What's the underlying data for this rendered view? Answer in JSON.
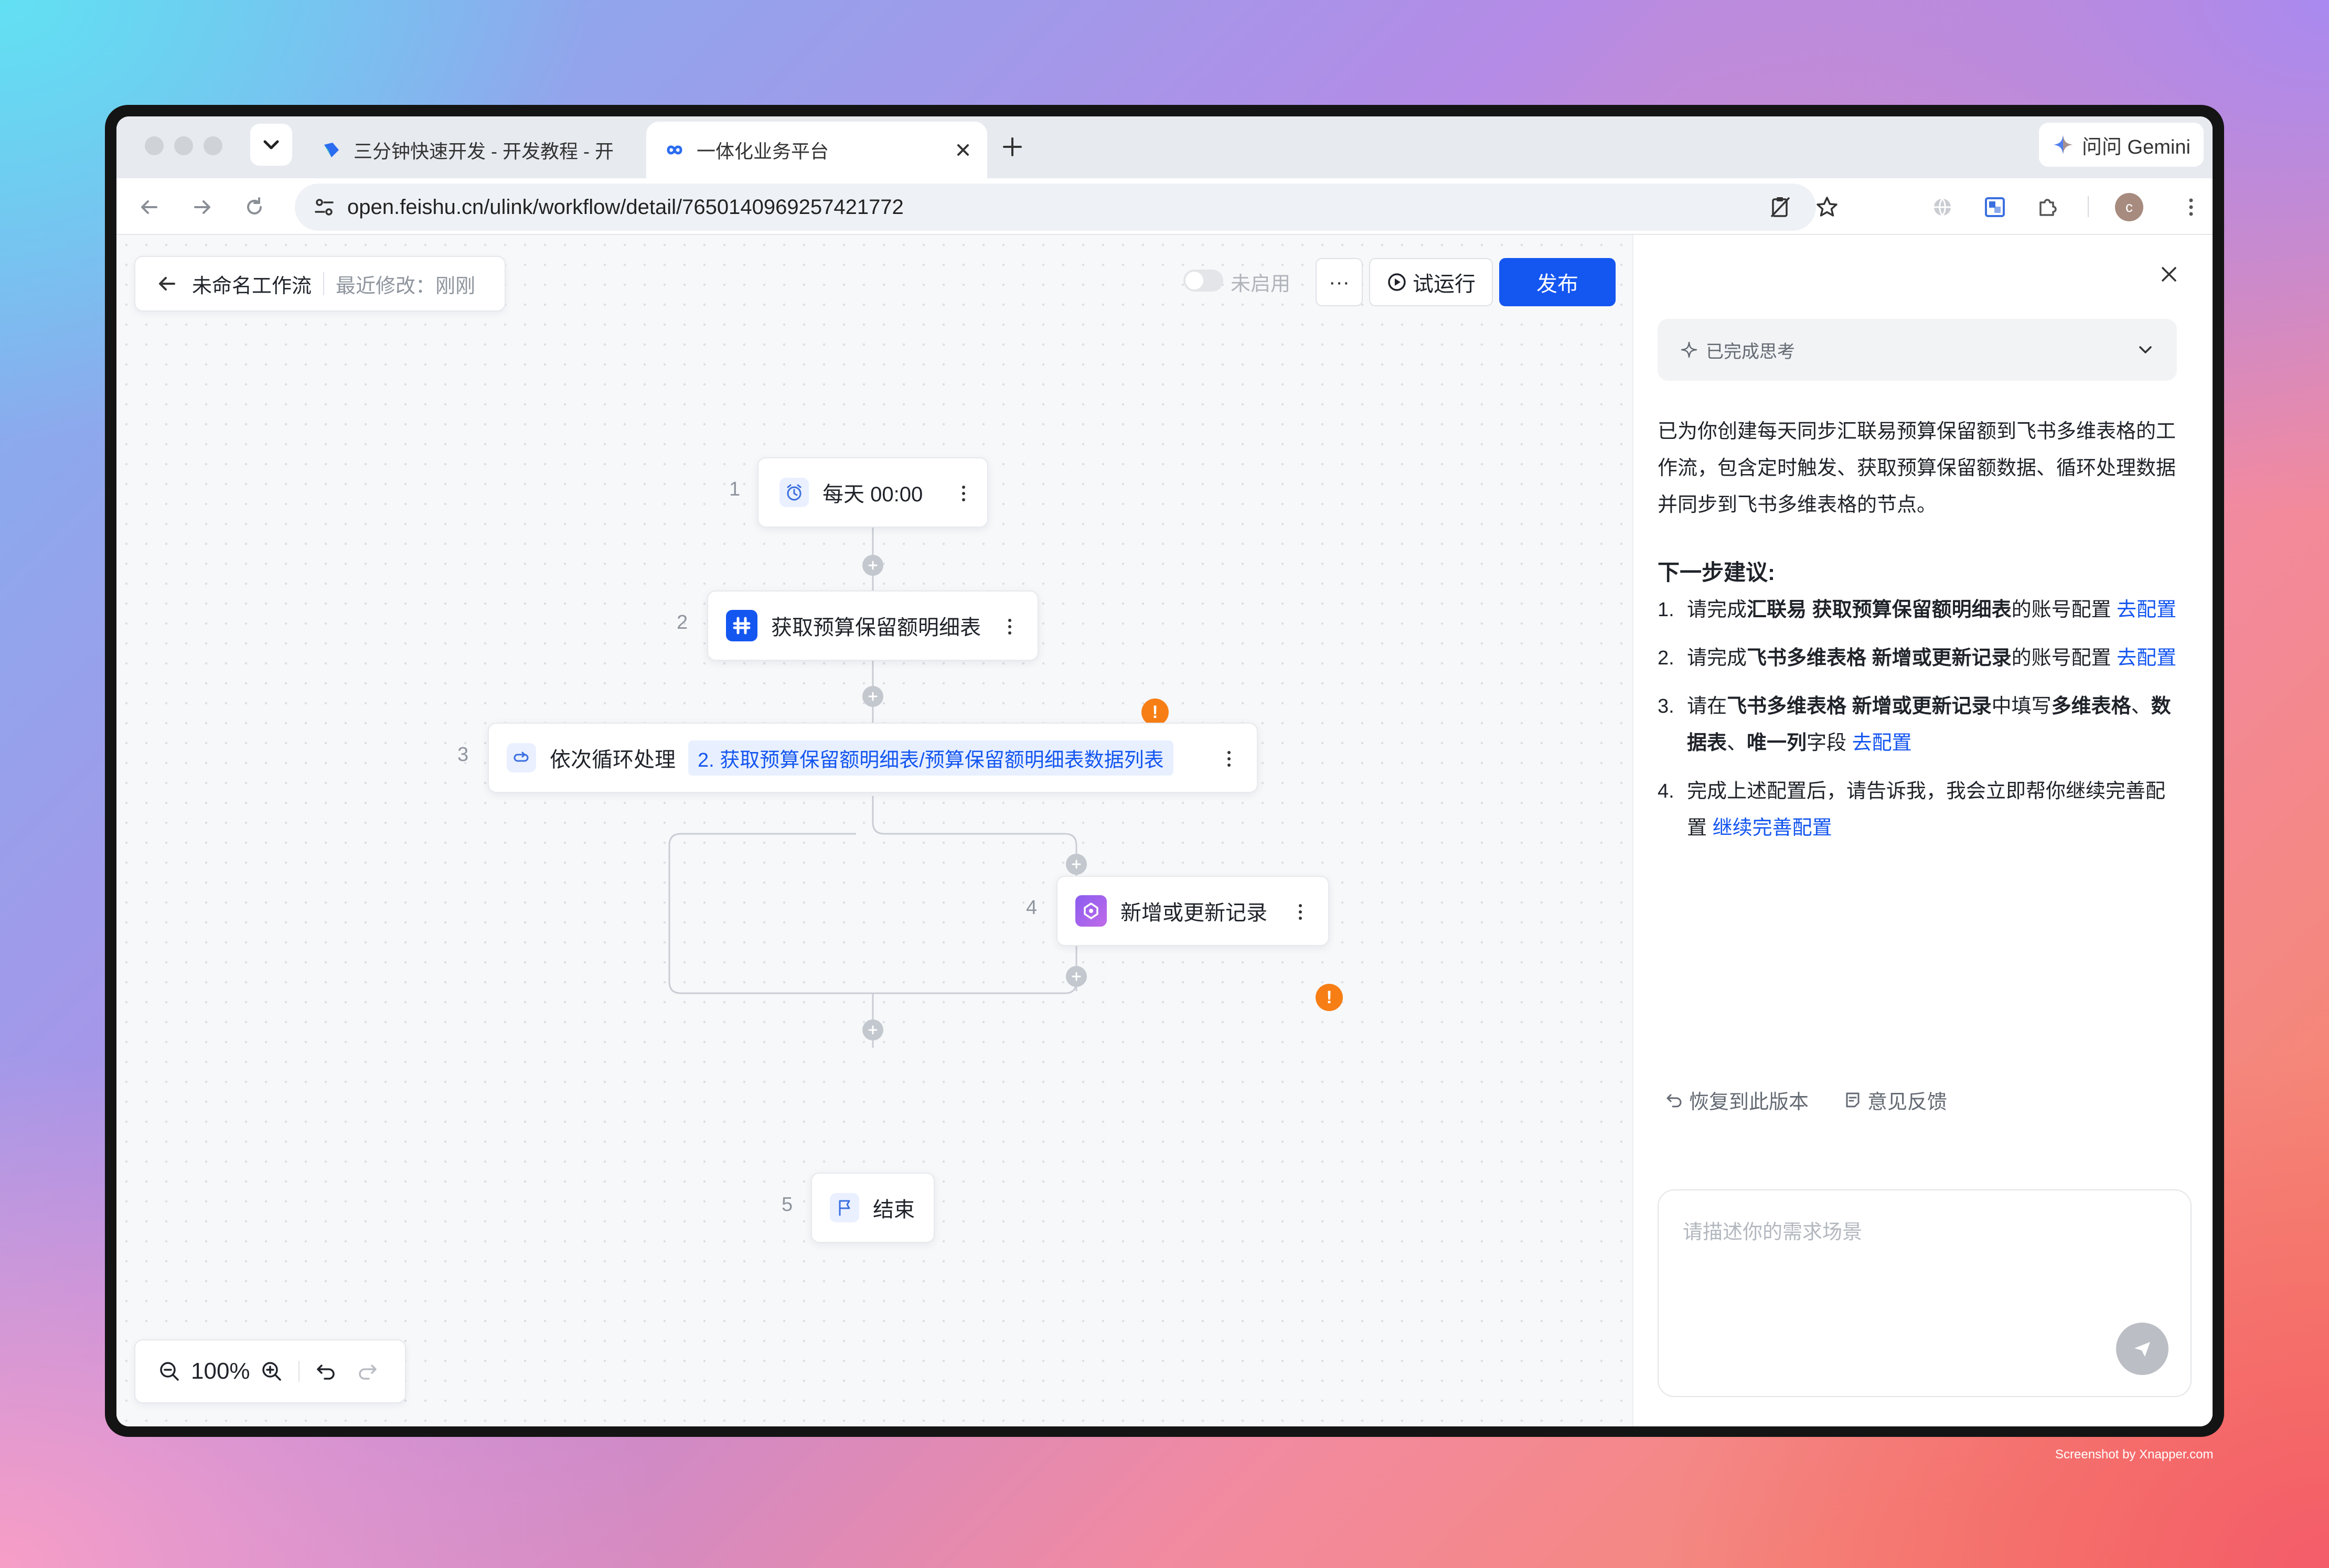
{
  "browser": {
    "tabs": [
      {
        "label": "三分钟快速开发 - 开发教程 - 开"
      },
      {
        "label": "一体化业务平台"
      }
    ],
    "gemini_label": "问问 Gemini",
    "url": "open.feishu.cn/ulink/workflow/detail/7650140969257421772",
    "avatar_letter": "c"
  },
  "header": {
    "title": "未命名工作流",
    "modified": "最近修改：刚刚"
  },
  "toolbar": {
    "toggle_label": "未启用",
    "more_label": "···",
    "try_run_label": "试运行",
    "publish_label": "发布"
  },
  "workflow": {
    "nodes": [
      {
        "number": "1",
        "label": "每天 00:00"
      },
      {
        "number": "2",
        "label": "获取预算保留额明细表"
      },
      {
        "number": "3",
        "label": "依次循环处理",
        "tag": "2. 获取预算保留额明细表/预算保留额明细表数据列表"
      },
      {
        "number": "4",
        "label": "新增或更新记录"
      },
      {
        "number": "5",
        "label": "结束"
      }
    ],
    "warning_glyph": "!"
  },
  "zoom": {
    "level": "100%"
  },
  "panel": {
    "thinking_label": "已完成思考",
    "message": "已为你创建每天同步汇联易预算保留额到飞书多维表格的工作流，包含定时触发、获取预算保留额数据、循环处理数据并同步到飞书多维表格的节点。",
    "next_heading": "下一步建议:",
    "steps": [
      {
        "n": "1.",
        "a": "请完成",
        "b": "汇联易 获取预算保留额明细表",
        "c": "的账号配置 ",
        "link": "去配置"
      },
      {
        "n": "2.",
        "a": "请完成",
        "b": "飞书多维表格 新增或更新记录",
        "c": "的账号配置 ",
        "link": "去配置"
      },
      {
        "n": "3.",
        "a": "请在",
        "b": "飞书多维表格 新增或更新记录",
        "c": "中填写",
        "b2": "多维表格",
        "c2": "、",
        "b3": "数据表",
        "c3": "、",
        "b4": "唯一列",
        "c4": "字段 ",
        "link": "去配置"
      },
      {
        "n": "4.",
        "a": "完成上述配置后，请告诉我，我会立即帮你继续完善配置 ",
        "link": "继续完善配置"
      }
    ],
    "restore_label": "恢复到此版本",
    "feedback_label": "意见反馈",
    "input_placeholder": "请描述你的需求场景"
  },
  "watermark": "Screenshot by Xnapper.com",
  "colors": {
    "accent": "#1456f0",
    "warning": "#f77e14",
    "link": "#1456f0"
  }
}
